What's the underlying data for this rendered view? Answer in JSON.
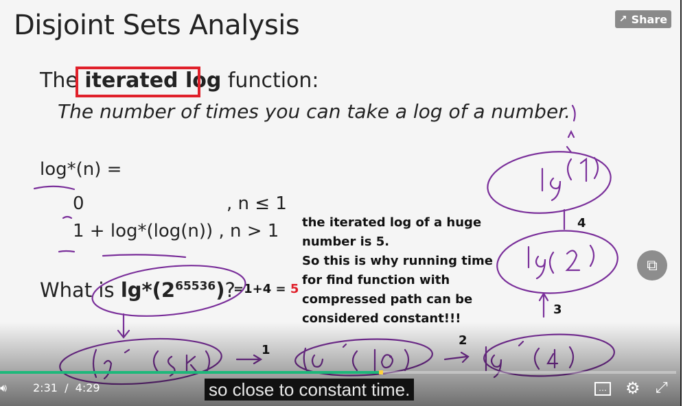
{
  "slide": {
    "title": "Disjoint Sets Analysis",
    "line1_pre": "The",
    "line1_highlight": "iterated log",
    "line1_post": "function:",
    "line2": "The number of times you can take a log of a number.",
    "def_head": "log*(n) =",
    "case1_value": "0",
    "case1_cond": ", n ≤ 1",
    "case2": "1 + log*(log(n)) , n > 1",
    "question_pre": "What is ",
    "question_bold": "lg*(2",
    "question_sup": "65536",
    "question_close": ")",
    "question_mark": "?",
    "answer_prefix": "=1+4 = ",
    "answer_value": "5",
    "note_lines": [
      "the iterated log of a huge",
      "number is 5.",
      "So this is why running time",
      "for find function with",
      "compressed path can be",
      "considered constant!!!"
    ],
    "step_numbers": [
      "1",
      "2",
      "3",
      "4"
    ]
  },
  "player": {
    "share_label": "Share",
    "current_time": "2:31",
    "separator": "/",
    "duration": "4:29",
    "progress_fraction": 0.563,
    "caption": "so close to constant time.",
    "cc_label": "…"
  },
  "icons": {
    "share": "share-icon",
    "volume": "volume-icon",
    "captions": "captions-icon",
    "settings": "gear-icon",
    "fullscreen": "fullscreen-icon",
    "pip": "picture-in-picture-icon"
  },
  "colors": {
    "highlight_box": "#e0202a",
    "ink": "#7a2f9a",
    "progress": "#1db87a",
    "answer_red": "#e0202a"
  }
}
